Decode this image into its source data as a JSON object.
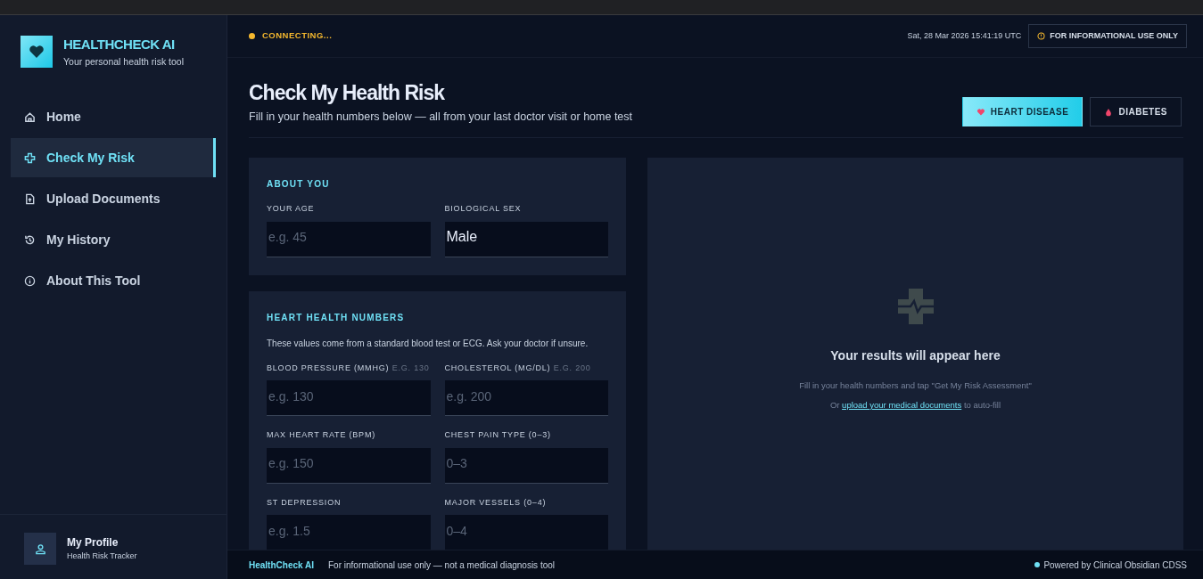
{
  "brand": {
    "title": "HEALTHCHECK AI",
    "subtitle": "Your personal health risk tool"
  },
  "sidebar": {
    "items": [
      {
        "label": "Home",
        "kind": "home",
        "selected": false
      },
      {
        "label": "Check My Risk",
        "kind": "plus",
        "selected": true
      },
      {
        "label": "Upload Documents",
        "kind": "file",
        "selected": false
      },
      {
        "label": "My History",
        "kind": "history",
        "selected": false
      },
      {
        "label": "About This Tool",
        "kind": "info",
        "selected": false
      }
    ]
  },
  "profile": {
    "name": "My Profile",
    "subtitle": "Health Risk Tracker"
  },
  "header": {
    "status": "CONNECTING...",
    "timestamp": "Sat, 28 Mar 2026 15:41:19 UTC",
    "notice": "FOR INFORMATIONAL USE ONLY"
  },
  "page": {
    "title": "Check My Health Risk",
    "subtitle": "Fill in your health numbers below — all from your last doctor visit or home test"
  },
  "tabs": [
    {
      "label": "HEART DISEASE",
      "kind": "heart",
      "selected": true
    },
    {
      "label": "DIABETES",
      "kind": "drop",
      "selected": false
    }
  ],
  "sections": [
    {
      "title": "ABOUT YOU",
      "fields": [
        {
          "label": "YOUR AGE",
          "placeholder": "e.g. 45"
        },
        {
          "label": "BIOLOGICAL SEX",
          "value": "Male"
        }
      ]
    },
    {
      "title": "HEART HEALTH NUMBERS",
      "note": "These values come from a standard blood test or ECG. Ask your doctor if unsure.",
      "fields": [
        {
          "label": "BLOOD PRESSURE (MMHG)",
          "hint": "E.G. 130",
          "placeholder": "e.g. 130"
        },
        {
          "label": "CHOLESTEROL (MG/DL)",
          "hint": "E.G. 200",
          "placeholder": "e.g. 200"
        },
        {
          "label": "MAX HEART RATE (BPM)",
          "placeholder": "e.g. 150"
        },
        {
          "label": "CHEST PAIN TYPE (0–3)",
          "placeholder": "0–3"
        },
        {
          "label": "ST DEPRESSION",
          "placeholder": "e.g. 1.5"
        },
        {
          "label": "MAJOR VESSELS (0–4)",
          "placeholder": "0–4"
        }
      ]
    }
  ],
  "results": {
    "title": "Your results will appear here",
    "hint": "Fill in your health numbers and tap \"Get My Risk Assessment\"",
    "upload_prefix": "Or",
    "upload_link": "upload your medical documents",
    "upload_suffix": "to auto-fill"
  },
  "footer": {
    "brand": "HealthCheck AI",
    "disclaimer": "For informational use only — not a medical diagnosis tool",
    "powered": "Powered by Clinical Obsidian CDSS"
  }
}
